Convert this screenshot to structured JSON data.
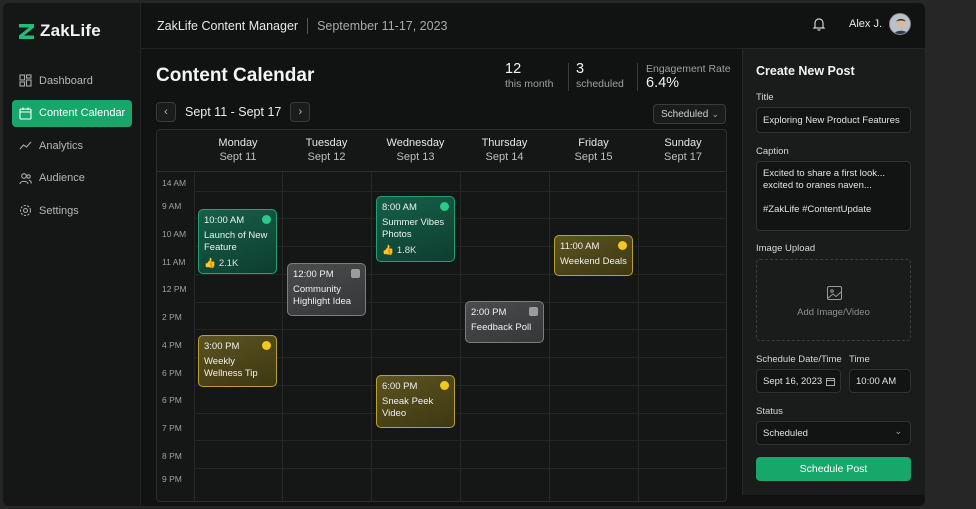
{
  "brand": {
    "name": "ZakLife"
  },
  "sidebar": {
    "items": [
      {
        "label": "Dashboard",
        "icon": "dashboard-icon",
        "active": false
      },
      {
        "label": "Content Calendar",
        "icon": "calendar-icon",
        "active": true
      },
      {
        "label": "Analytics",
        "icon": "analytics-icon",
        "active": false
      },
      {
        "label": "Audience",
        "icon": "audience-icon",
        "active": false
      },
      {
        "label": "Settings",
        "icon": "gear-icon",
        "active": false
      }
    ]
  },
  "header": {
    "title": "ZakLife Content Manager",
    "range": "September 11-17, 2023",
    "user": "Alex J."
  },
  "main": {
    "title": "Content Calendar",
    "stats": [
      {
        "value": "12",
        "label": "this month"
      },
      {
        "value": "3",
        "label": "scheduled"
      },
      {
        "value": "6.4%",
        "label": "Engagement Rate"
      }
    ],
    "week_label": "Sept 11 - Sept 17",
    "filter": "Scheduled"
  },
  "calendar": {
    "days": [
      {
        "name": "Monday",
        "date": "Sept 11"
      },
      {
        "name": "Tuesday",
        "date": "Sept 12"
      },
      {
        "name": "Wednesday",
        "date": "Sept 13"
      },
      {
        "name": "Thursday",
        "date": "Sept 14"
      },
      {
        "name": "Friday",
        "date": "Sept 15"
      },
      {
        "name": "Sunday",
        "date": "Sept 17"
      }
    ],
    "times": [
      "14 AM",
      "9 AM",
      "10 AM",
      "11 AM",
      "12 PM",
      "2 PM",
      "4 PM",
      "6 PM",
      "6 PM",
      "7 PM",
      "8 PM",
      "9 PM"
    ],
    "events": [
      {
        "time": "10:00 AM",
        "title": "Launch of New Feature",
        "likes": "2.1K",
        "status": "published"
      },
      {
        "time": "3:00 PM",
        "title": "Weekly Wellness Tip",
        "likes": "",
        "status": "scheduled"
      },
      {
        "time": "12:00 PM",
        "title": "Community Highlight Idea",
        "likes": "",
        "status": "draft"
      },
      {
        "time": "8:00 AM",
        "title": "Summer Vibes Photos",
        "likes": "1.8K",
        "status": "published"
      },
      {
        "time": "6:00 PM",
        "title": "Sneak Peek Video",
        "likes": "",
        "status": "scheduled"
      },
      {
        "time": "2:00 PM",
        "title": "Feedback Poll",
        "likes": "",
        "status": "draft"
      },
      {
        "time": "11:00 AM",
        "title": "Weekend Deals",
        "likes": "",
        "status": "scheduled"
      }
    ]
  },
  "form": {
    "heading": "Create New Post",
    "title_label": "Title",
    "title_value": "Exploring New Product Features",
    "caption_label": "Caption",
    "caption_value": "Excited to share a first look... excited to oranes naven...\n\n#ZakLife #ContentUpdate",
    "upload_label": "Image Upload",
    "upload_text": "Add Image/Video",
    "schedule_label": "Schedule Date/Time",
    "time_label": "Time",
    "date_value": "Sept 16, 2023",
    "time_value": "10:00 AM",
    "status_label": "Status",
    "status_value": "Scheduled",
    "submit_label": "Schedule Post"
  },
  "colors": {
    "accent": "#17a76a",
    "published": "#2cc98a",
    "scheduled": "#f2c81f",
    "draft": "#9a9c9e"
  }
}
